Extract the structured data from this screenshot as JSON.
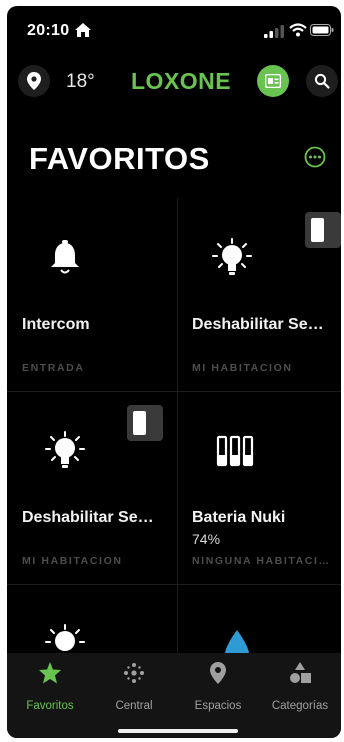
{
  "status_bar": {
    "time": "20:10"
  },
  "header": {
    "temperature": "18°",
    "logo": "LOXONE"
  },
  "page_title": "FAVORITOS",
  "tiles": [
    {
      "name": "Intercom",
      "room": "ENTRADA",
      "icon": "bell-icon"
    },
    {
      "name": "Deshabilitar Se…",
      "room": "MI HABITACION",
      "icon": "lightbulb-icon"
    },
    {
      "name": "Deshabilitar Se…",
      "room": "MI HABITACION",
      "icon": "lightbulb-icon"
    },
    {
      "name": "Bateria Nuki",
      "value": "74%",
      "room": "NINGUNA HABITACI…",
      "icon": "battery-bars-icon"
    },
    {
      "icon": "lightbulb-icon"
    },
    {
      "icon": "water-drop-icon"
    }
  ],
  "tabs": [
    {
      "label": "Favoritos",
      "icon": "star-icon",
      "active": true
    },
    {
      "label": "Central",
      "icon": "central-dots-icon",
      "active": false
    },
    {
      "label": "Espacios",
      "icon": "location-pin-icon",
      "active": false
    },
    {
      "label": "Categorías",
      "icon": "categories-icon",
      "active": false
    }
  ],
  "colors": {
    "accent": "#69c350",
    "background": "#000000",
    "room_label": "#4d4d4d"
  }
}
